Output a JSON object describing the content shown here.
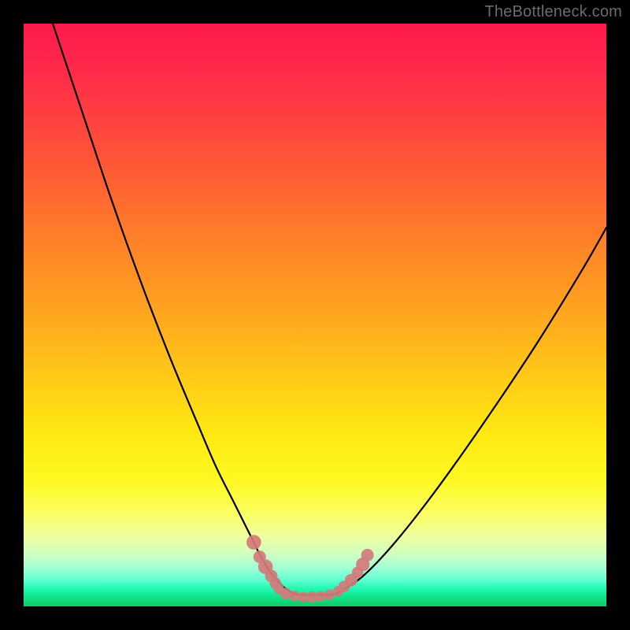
{
  "watermark": {
    "text": "TheBottleneck.com"
  },
  "colors": {
    "frame": "#000000",
    "curve": "#000000",
    "markers": "#d47a7a",
    "watermark_text": "#6b6b6b"
  },
  "chart_data": {
    "type": "line",
    "title": "",
    "xlabel": "",
    "ylabel": "",
    "xlim": [
      0,
      100
    ],
    "ylim": [
      0,
      100
    ],
    "grid": false,
    "legend": false,
    "series": [
      {
        "name": "bottleneck-curve",
        "x": [
          5,
          10,
          15,
          20,
          25,
          30,
          33,
          36,
          39,
          41,
          43,
          45,
          47,
          50,
          53,
          55,
          58,
          62,
          67,
          73,
          80,
          88,
          96,
          100
        ],
        "y": [
          100,
          85,
          70,
          56,
          43,
          31,
          24,
          18,
          12,
          8,
          5,
          3,
          2,
          2,
          2,
          3,
          5,
          9,
          15,
          23,
          33,
          45,
          58,
          65
        ]
      }
    ],
    "markers": [
      {
        "x": 39.5,
        "y": 11,
        "r": 1.4
      },
      {
        "x": 40.5,
        "y": 8.5,
        "r": 1.2
      },
      {
        "x": 41.5,
        "y": 6.8,
        "r": 1.4
      },
      {
        "x": 42.5,
        "y": 5.2,
        "r": 1.2
      },
      {
        "x": 43.2,
        "y": 4.0,
        "r": 1.1
      },
      {
        "x": 43.8,
        "y": 3.0,
        "r": 1.0
      },
      {
        "x": 45.0,
        "y": 2.2,
        "r": 1.1
      },
      {
        "x": 46.5,
        "y": 1.8,
        "r": 1.0
      },
      {
        "x": 48.0,
        "y": 1.6,
        "r": 1.0
      },
      {
        "x": 49.5,
        "y": 1.6,
        "r": 1.1
      },
      {
        "x": 51.0,
        "y": 1.7,
        "r": 1.0
      },
      {
        "x": 52.5,
        "y": 2.0,
        "r": 1.0
      },
      {
        "x": 54.0,
        "y": 2.6,
        "r": 1.0
      },
      {
        "x": 55.0,
        "y": 3.4,
        "r": 1.1
      },
      {
        "x": 56.2,
        "y": 4.5,
        "r": 1.2
      },
      {
        "x": 57.3,
        "y": 5.8,
        "r": 1.1
      },
      {
        "x": 58.2,
        "y": 7.2,
        "r": 1.3
      },
      {
        "x": 59.0,
        "y": 8.8,
        "r": 1.2
      }
    ]
  }
}
